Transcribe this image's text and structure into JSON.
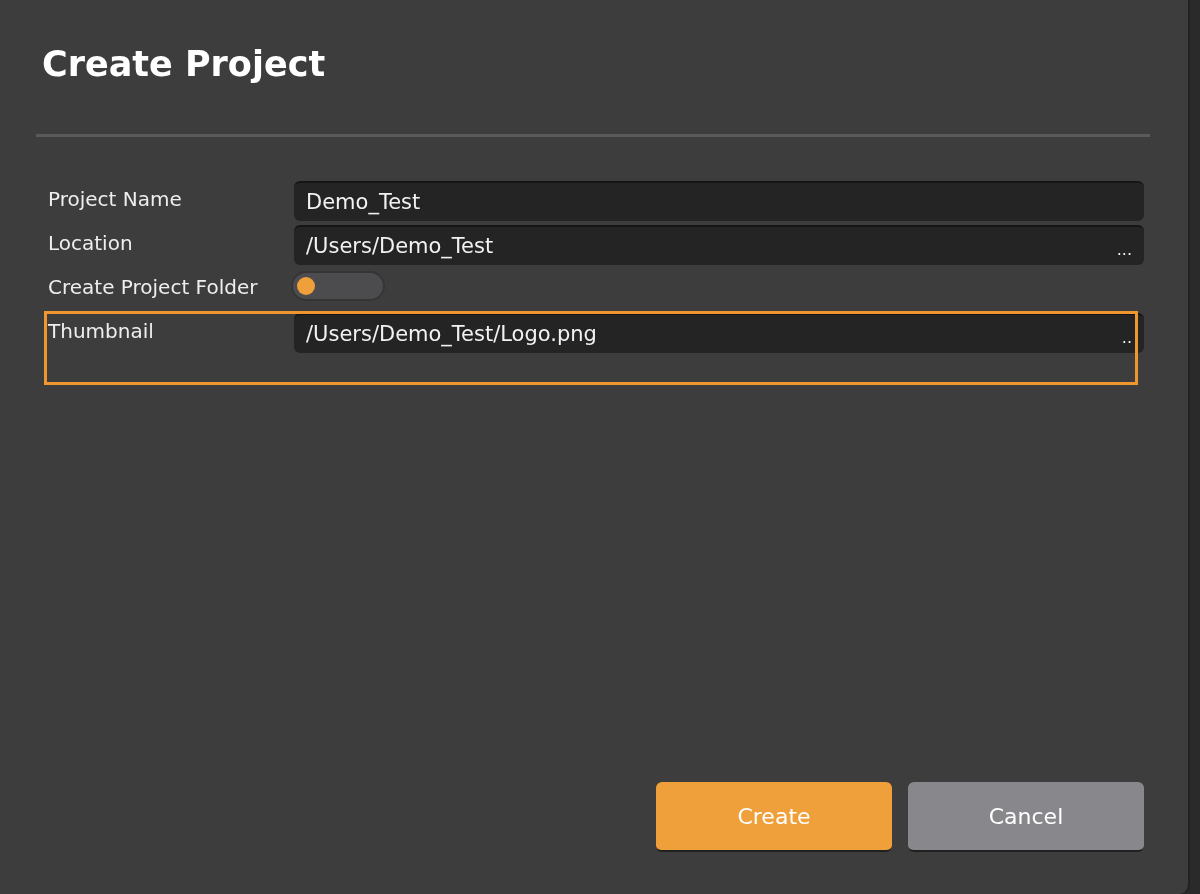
{
  "dialog": {
    "title": "Create Project"
  },
  "fields": [
    {
      "kind": "text",
      "label": "Project Name",
      "value": "Demo_Test",
      "highlighted": false
    },
    {
      "kind": "path",
      "label": "Location",
      "value": "/Users/Demo_Test",
      "browse": "...",
      "highlighted": false
    },
    {
      "kind": "toggle",
      "label": "Create Project Folder",
      "on": false,
      "highlighted": false
    },
    {
      "kind": "path",
      "label": "Thumbnail",
      "value": "/Users/Demo_Test/Logo.png",
      "browse": "..",
      "highlighted": true
    }
  ],
  "buttons": [
    {
      "label": "Create",
      "kind": "primary"
    },
    {
      "label": "Cancel",
      "kind": "secondary"
    }
  ]
}
